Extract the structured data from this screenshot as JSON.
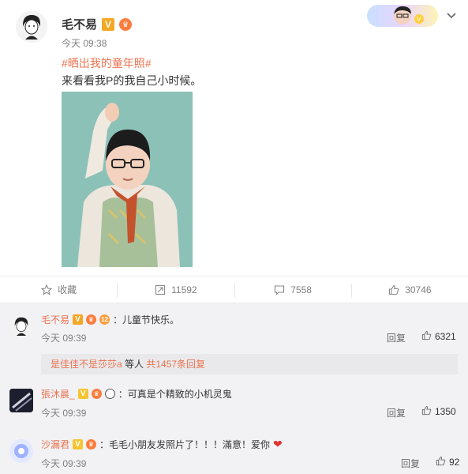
{
  "post": {
    "author": "毛不易",
    "verified_badge": "V",
    "time": "今天 09:38",
    "hashtag": "#晒出我的童年照#",
    "text": "来看看我P的我自己小时候。"
  },
  "actions": [
    {
      "label": "收藏",
      "icon": "star-icon"
    },
    {
      "label": "11592",
      "icon": "repost-icon"
    },
    {
      "label": "7558",
      "icon": "comment-icon"
    },
    {
      "label": "30746",
      "icon": "like-icon"
    }
  ],
  "comments": [
    {
      "name": "毛不易",
      "text": "：儿童节快乐。",
      "time": "今天 09:39",
      "reply_label": "回复",
      "likes": "6321",
      "subreply": {
        "name": "是佳佳不是莎莎a",
        "middle": " 等人 ",
        "count": "共1457条回复"
      }
    },
    {
      "name": "張沐晨_",
      "text": "：可真是个精致的小机灵鬼",
      "time": "今天 09:39",
      "reply_label": "回复",
      "likes": "1350"
    },
    {
      "name": "沙漏君",
      "text": "：毛毛小朋友发照片了！！！滿意！爱你",
      "time": "今天 09:39",
      "reply_label": "回复",
      "likes": "92"
    }
  ],
  "colors": {
    "accent": "#eb7350",
    "badge": "#f5a623",
    "heart": "#e0322e"
  }
}
